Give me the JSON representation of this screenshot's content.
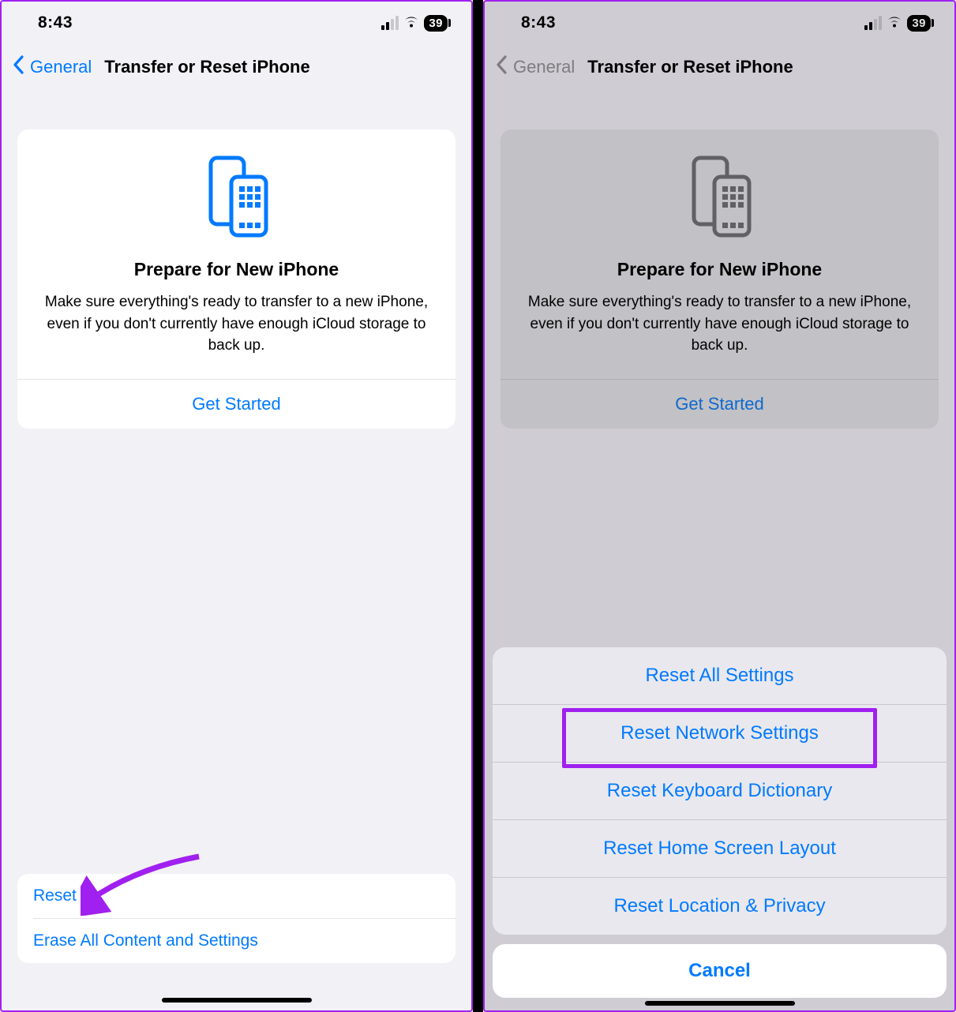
{
  "statusbar": {
    "time": "8:43",
    "battery": "39"
  },
  "nav": {
    "back_label": "General",
    "title": "Transfer or Reset iPhone"
  },
  "card": {
    "title": "Prepare for New iPhone",
    "desc": "Make sure everything's ready to transfer to a new iPhone, even if you don't currently have enough iCloud storage to back up.",
    "get_started": "Get Started"
  },
  "bottom": {
    "reset": "Reset",
    "erase": "Erase All Content and Settings"
  },
  "sheet": {
    "items": [
      "Reset All Settings",
      "Reset Network Settings",
      "Reset Keyboard Dictionary",
      "Reset Home Screen Layout",
      "Reset Location & Privacy"
    ],
    "cancel": "Cancel"
  },
  "colors": {
    "accent": "#007aff",
    "annotation": "#a020f0"
  }
}
